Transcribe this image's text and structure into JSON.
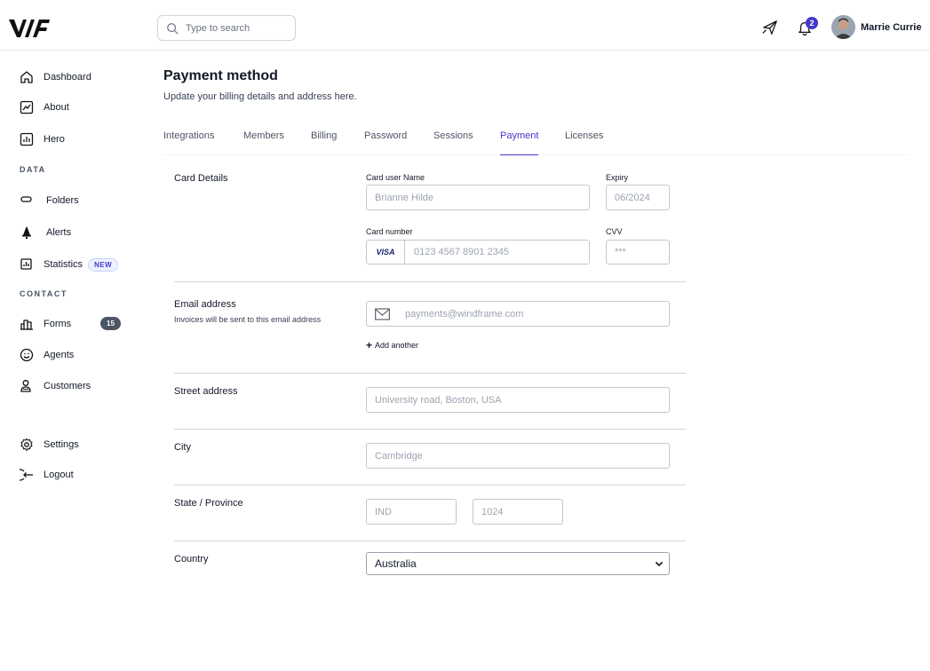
{
  "header": {
    "logo_icon": "windframe-logo",
    "search_placeholder": "Type to search",
    "notification_count": "2",
    "user_name": "Marrie Currie"
  },
  "sidebar": {
    "items": [
      {
        "label": "Dashboard",
        "icon": "home-icon"
      },
      {
        "label": "About",
        "icon": "chart-line-icon"
      },
      {
        "label": "Hero",
        "icon": "bar-chart-icon"
      }
    ],
    "section_data": "DATA",
    "data_items": [
      {
        "label": "Folders",
        "icon": "folder-icon"
      },
      {
        "label": "Alerts",
        "icon": "bell-icon"
      },
      {
        "label": "Statistics",
        "icon": "stats-icon",
        "badge": "NEW"
      }
    ],
    "section_contact": "CONTACT",
    "contact_items": [
      {
        "label": "Forms",
        "icon": "forms-icon",
        "count": "15"
      },
      {
        "label": "Agents",
        "icon": "smile-icon"
      },
      {
        "label": "Customers",
        "icon": "users-icon"
      }
    ],
    "bottom_items": [
      {
        "label": "Settings",
        "icon": "gear-icon"
      },
      {
        "label": "Logout",
        "icon": "logout-icon"
      }
    ]
  },
  "main": {
    "title": "Payment method",
    "subtitle": "Update your billing details and address here.",
    "tabs": [
      {
        "label": "Integrations"
      },
      {
        "label": "Members"
      },
      {
        "label": "Billing"
      },
      {
        "label": "Password"
      },
      {
        "label": "Sessions"
      },
      {
        "label": "Payment",
        "active": true
      },
      {
        "label": "Licenses"
      }
    ],
    "card_details": {
      "section_label": "Card Details",
      "name_label": "Card user Name",
      "name_placeholder": "Brianne Hilde",
      "expiry_label": "Expiry",
      "expiry_placeholder": "06/2024",
      "number_label": "Card number",
      "card_brand": "VISA",
      "number_placeholder": "0123 4567 8901 2345",
      "cvv_label": "CVV",
      "cvv_placeholder": "***"
    },
    "email": {
      "label": "Email address",
      "hint": "Invoices will be sent to this email address",
      "placeholder": "payments@windframe.com",
      "add_another": "Add another"
    },
    "street": {
      "label": "Street address",
      "placeholder": "University road, Boston, USA"
    },
    "city": {
      "label": "City",
      "placeholder": "Cambridge"
    },
    "state": {
      "label": "State / Province",
      "state_placeholder": "IND",
      "zip_placeholder": "1024"
    },
    "country": {
      "label": "Country",
      "selected": "Australia"
    }
  },
  "colors": {
    "accent": "#4338ca",
    "badge_bg": "#4b5563",
    "divider": "#d1d5db"
  }
}
